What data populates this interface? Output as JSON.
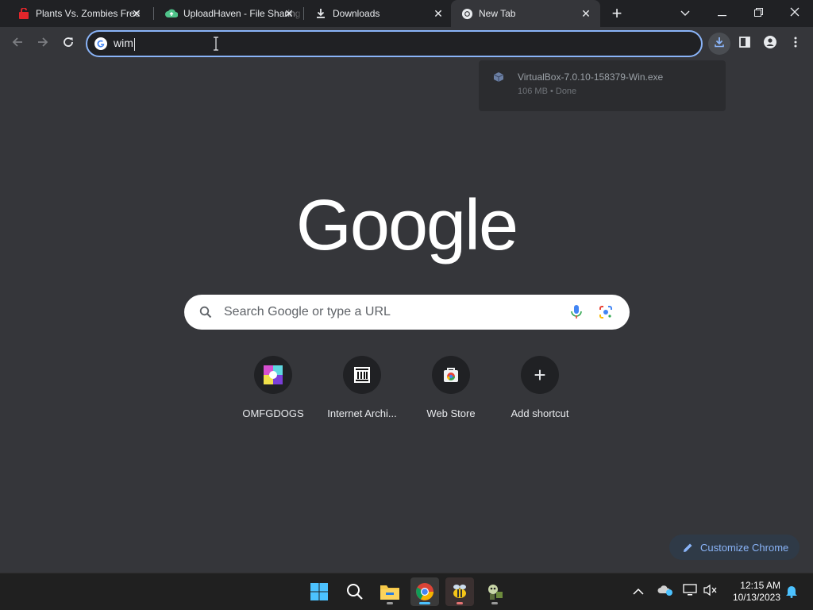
{
  "tabs": [
    {
      "label": "Plants Vs. Zombies Free",
      "icon": "pvz-red-icon",
      "close": "✕"
    },
    {
      "label": "UploadHaven - File Sharing",
      "icon": "cloud-upload-icon",
      "close": "✕"
    },
    {
      "label": "Downloads",
      "icon": "download-icon",
      "close": "✕"
    },
    {
      "label": "New Tab",
      "icon": "chrome-icon",
      "close": "✕",
      "active": true
    }
  ],
  "new_tab_symbol": "+",
  "omnibox": {
    "value": "wim"
  },
  "download_bubble": {
    "filename": "VirtualBox-7.0.10-158379-Win.exe",
    "status": "106 MB • Done"
  },
  "logo_text": "Google",
  "search": {
    "placeholder": "Search Google or type a URL"
  },
  "shortcuts": [
    {
      "label": "OMFGDOGS",
      "icon": "omfgdogs-icon"
    },
    {
      "label": "Internet Archi...",
      "icon": "internet-archive-icon"
    },
    {
      "label": "Web Store",
      "icon": "web-store-icon"
    },
    {
      "label": "Add shortcut",
      "icon": "plus-icon",
      "symbol": "+"
    }
  ],
  "customize_label": "Customize Chrome",
  "taskbar": {
    "apps": [
      "windows-start-icon",
      "search-icon",
      "file-explorer-icon",
      "chrome-icon",
      "bee-app-icon",
      "pvz-app-icon"
    ],
    "time": "12:15 AM",
    "date": "10/13/2023"
  },
  "colors": {
    "accent": "#8ab4f8",
    "background": "#35363a",
    "tabstrip": "#202124"
  }
}
